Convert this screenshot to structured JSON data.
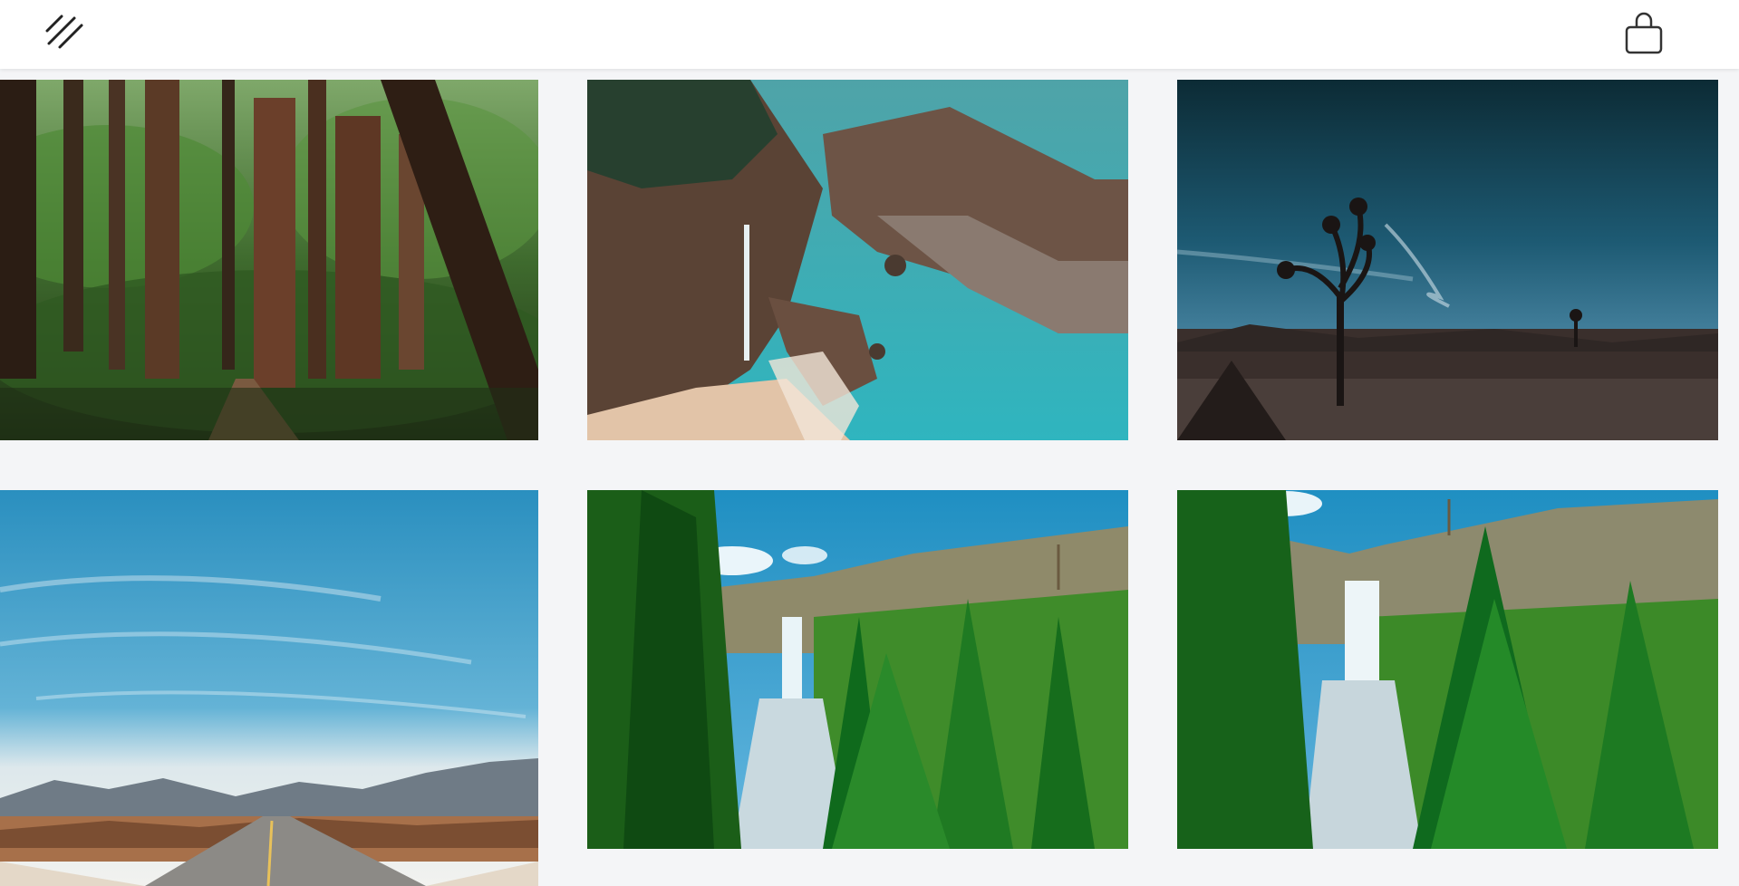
{
  "header": {
    "logo_icon": "slashes-logo-icon",
    "cart_icon": "shopping-bag-icon"
  },
  "gallery": {
    "tiles": [
      {
        "subject": "redwood-forest-trail"
      },
      {
        "subject": "coastal-waterfall-cove"
      },
      {
        "subject": "joshua-tree-dusk"
      },
      {
        "subject": "desert-road-blue-sky"
      },
      {
        "subject": "waterfall-canyon-pines"
      },
      {
        "subject": "waterfall-canyon-pines-closeup"
      }
    ]
  },
  "colors": {
    "page_background": "#f4f5f7",
    "header_background": "#ffffff",
    "icon_color": "#222222"
  }
}
